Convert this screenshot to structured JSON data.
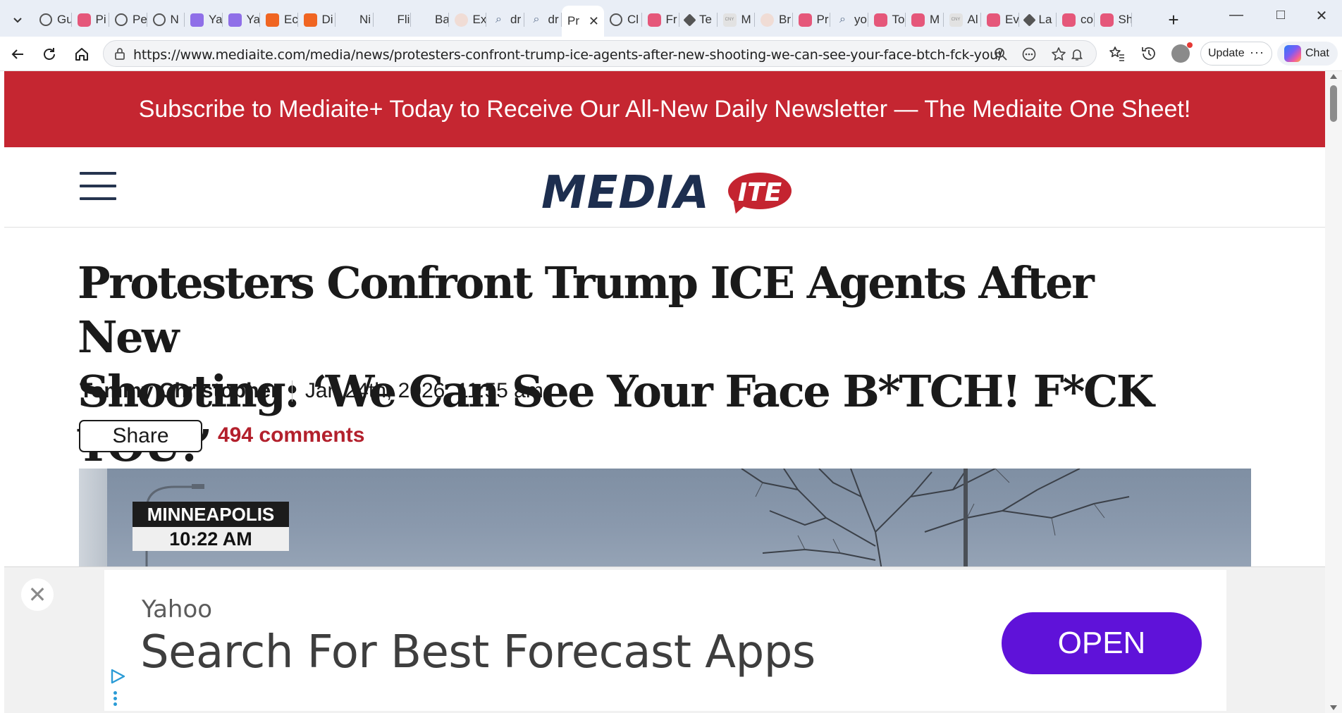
{
  "browser": {
    "tabs": [
      {
        "label": "Gu",
        "icon": "globe-icon"
      },
      {
        "label": "Pi",
        "icon": "youtube-icon"
      },
      {
        "label": "Pe",
        "icon": "globe-icon"
      },
      {
        "label": "N",
        "icon": "globe-icon"
      },
      {
        "label": "Ya",
        "icon": "yahoo-icon"
      },
      {
        "label": "Ya",
        "icon": "yahoo-icon"
      },
      {
        "label": "Ec",
        "icon": "bookmark-icon"
      },
      {
        "label": "Di",
        "icon": "bookmark-icon"
      },
      {
        "label": "Ni",
        "icon": "logo-icon"
      },
      {
        "label": "Fli",
        "icon": "bird-icon"
      },
      {
        "label": "Ba",
        "icon": "logo-icon"
      },
      {
        "label": "Ex",
        "icon": "seal-icon"
      },
      {
        "label": "dr",
        "icon": "search-icon"
      },
      {
        "label": "dr",
        "icon": "search-icon"
      },
      {
        "label": "Pr",
        "icon": "none",
        "active": true
      },
      {
        "label": "Cl",
        "icon": "globe-icon"
      },
      {
        "label": "Fr",
        "icon": "youtube-icon"
      },
      {
        "label": "Te",
        "icon": "diamond-icon"
      },
      {
        "label": "M",
        "icon": "cny-icon"
      },
      {
        "label": "Br",
        "icon": "seal-icon"
      },
      {
        "label": "Pr",
        "icon": "youtube-icon"
      },
      {
        "label": "yo",
        "icon": "search-icon"
      },
      {
        "label": "To",
        "icon": "youtube-icon"
      },
      {
        "label": "M",
        "icon": "youtube-icon"
      },
      {
        "label": "Al",
        "icon": "cny-icon"
      },
      {
        "label": "Ev",
        "icon": "youtube-icon"
      },
      {
        "label": "La",
        "icon": "diamond-icon"
      },
      {
        "label": "co",
        "icon": "youtube-icon"
      },
      {
        "label": "Sh",
        "icon": "youtube-icon"
      }
    ],
    "url": "https://www.mediaite.com/media/news/protesters-confront-trump-ice-agents-after-new-shooting-we-can-see-your-face-btch-fck-you/",
    "update_label": "Update",
    "chat_label": "Chat"
  },
  "page": {
    "promo_text": "Subscribe to Mediaite+ Today to Receive Our All-New Daily Newsletter — The Mediaite One Sheet!",
    "logo_main": "MEDIA",
    "logo_bubble": "ITE",
    "headline_line1": "Protesters Confront Trump ICE Agents After New",
    "headline_line2": "Shooting: ‘We Can See Your Face B*TCH! F*CK YOU!’",
    "author": "Tommy Christopher",
    "date": "Jan 24th, 2026, 11:55 am",
    "share_label": "Share",
    "comments_label": "494 comments",
    "hero_city": "MINNEAPOLIS",
    "hero_time": "10:22 AM"
  },
  "ad": {
    "advertiser": "Yahoo",
    "title": "Search For Best Forecast Apps",
    "cta": "OPEN"
  },
  "colors": {
    "promo_bg": "#c52631",
    "logo_navy": "#1d2e4f",
    "logo_red": "#c42430",
    "comments_red": "#b3202c",
    "cta_purple": "#5f12d9"
  }
}
